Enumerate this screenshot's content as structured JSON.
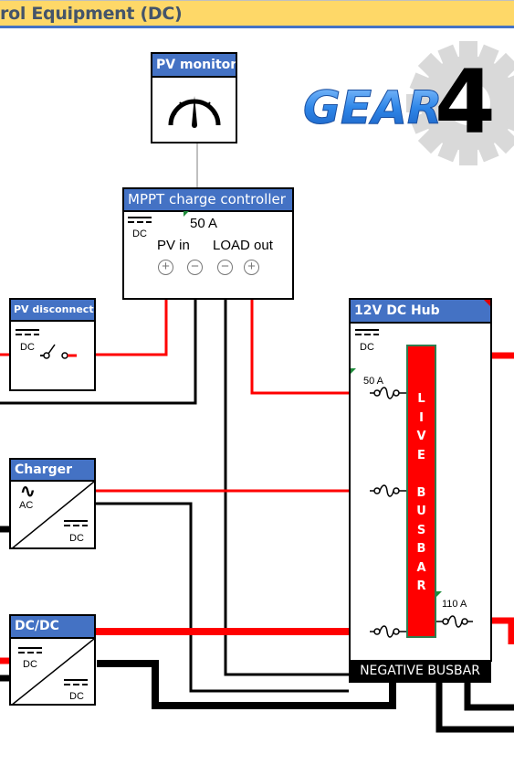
{
  "header": {
    "title": "rol Equipment (DC)"
  },
  "logo": {
    "text": "GEAR",
    "numeral": "4",
    "icon": "gear-icon"
  },
  "components": {
    "pv_monitor": {
      "title": "PV monitor",
      "icon": "gauge-icon"
    },
    "mppt": {
      "title": "MPPT charge controller",
      "dc_label": "DC",
      "rating": "50  A",
      "pv_in": "PV in",
      "load_out": "LOAD out",
      "terminals": [
        "+",
        "−",
        "−",
        "+"
      ]
    },
    "pv_disconnect": {
      "title": "PV disconnect",
      "dc_label": "DC",
      "icon": "switch-icon"
    },
    "charger": {
      "title": "Charger",
      "ac_symbol": "∿",
      "ac_label": "AC",
      "dc_label": "DC"
    },
    "dcdc": {
      "title": "DC/DC",
      "dc_in_label": "DC",
      "dc_out_label": "DC"
    },
    "hub": {
      "title": "12V DC Hub",
      "dc_label": "DC",
      "fuses": [
        {
          "label": "50 A"
        },
        {
          "label": ""
        },
        {
          "label": ""
        }
      ],
      "out_fuse": {
        "label": "110 A"
      },
      "live_busbar": "L\nI\nV\nE\n\nB\nU\nS\nB\nA\nR",
      "negative_busbar": "NEGATIVE BUSBAR"
    }
  },
  "colors": {
    "positive_wire": "#FF0000",
    "negative_wire": "#000000",
    "header_bg": "#4472C4",
    "title_bg": "#FED868",
    "title_text": "#44546A",
    "busbar_border": "#2E7D4F"
  }
}
